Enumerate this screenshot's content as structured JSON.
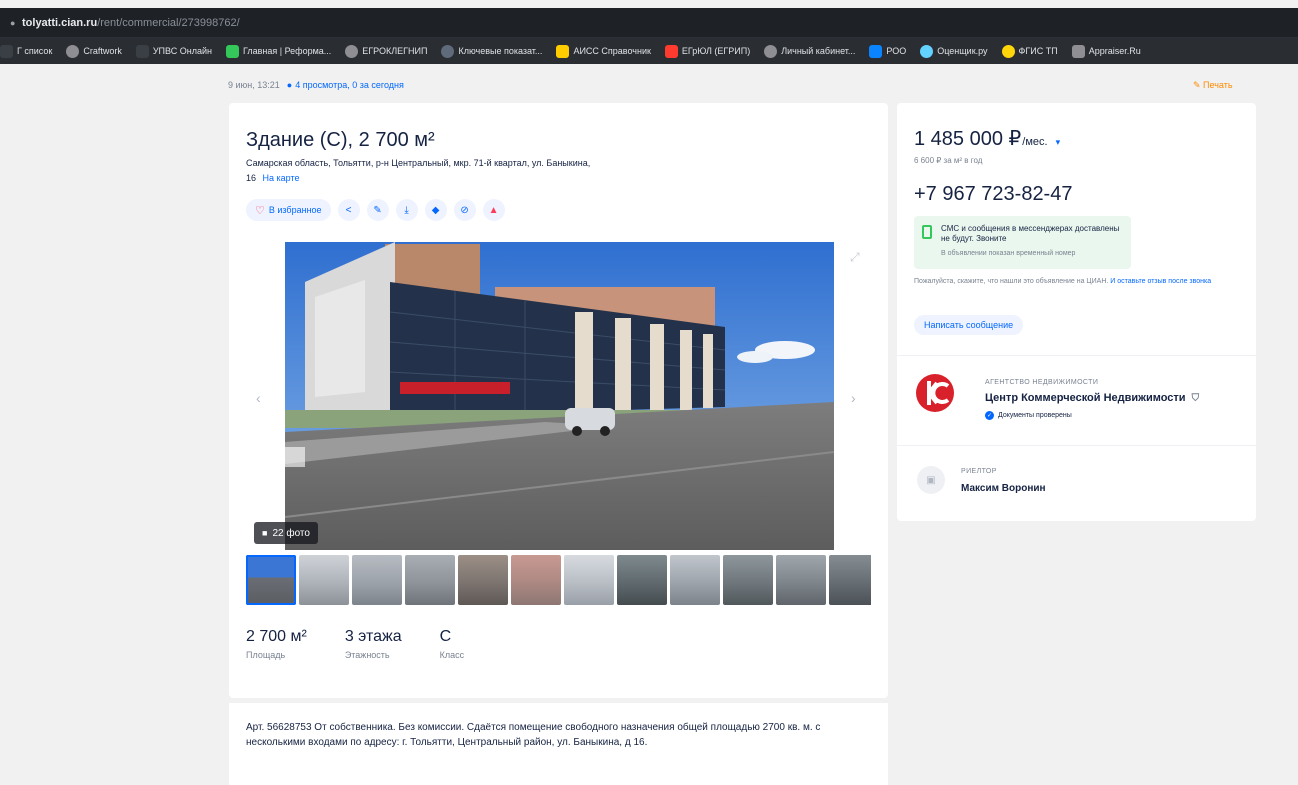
{
  "browser": {
    "url_host": "tolyatti.cian.ru",
    "url_path": "/rent/commercial/273998762/"
  },
  "bookmarks": [
    {
      "label": "Г список",
      "color": "#3a3f46"
    },
    {
      "label": "Craftwork",
      "color": "#8e8e93"
    },
    {
      "label": "УПВС Онлайн",
      "color": "#3a3f46"
    },
    {
      "label": "Главная | Реформа...",
      "color": "#34c759"
    },
    {
      "label": "ЕГРОКЛЕГНИП",
      "color": "#8e8e93"
    },
    {
      "label": "Ключевые показат...",
      "color": "#5f6b7a"
    },
    {
      "label": "АИСС Справочник",
      "color": "#ffcc00"
    },
    {
      "label": "ЕГрЮЛ (ЕГРИП)",
      "color": "#ff3b30"
    },
    {
      "label": "Личный кабинет...",
      "color": "#8e8e93"
    },
    {
      "label": "РОО",
      "color": "#0a84ff"
    },
    {
      "label": "Оценщик.ру",
      "color": "#64d2ff"
    },
    {
      "label": "ФГИС ТП",
      "color": "#ffd60a"
    },
    {
      "label": "Appraiser.Ru",
      "color": "#8e8e93"
    }
  ],
  "meta": {
    "date": "9 июн, 13:21",
    "views": "4 просмотра, 0 за сегодня",
    "print_label": "Печать"
  },
  "listing": {
    "title": "Здание (С), 2 700 м²",
    "address": "Самарская область, Тольятти, р-н Центральный, мкр. 71-й квартал, ул. Баныкина,",
    "address_house": "16",
    "map_link": "На карте",
    "favorite_label": "В избранное",
    "photo_count": "22 фото",
    "facts": [
      {
        "value": "2 700 м²",
        "label": "Площадь"
      },
      {
        "value": "3 этажа",
        "label": "Этажность"
      },
      {
        "value": "С",
        "label": "Класс"
      }
    ],
    "description": "Арт. 56628753 От собственника. Без комиссии. Сдаётся помещение свободного назначения общей площадью 2700 кв. м. с несколькими входами по адресу: г. Тольятти, Центральный район, ул. Баныкина, д 16."
  },
  "side": {
    "price": "1 485 000 ₽",
    "price_unit": "/мес.",
    "price_per_m2": "6 600 ₽ за м² в год",
    "phone": "+7 967 723-82-47",
    "sms_notice": "СМС и сообщения в мессенджерах доставлены не будут. Звоните",
    "sms_sub": "В объявлении показан временный номер",
    "note": "Пожалуйста, скажите, что нашли это объявление на ЦИАН.",
    "note_link": "И оставьте отзыв после звонка",
    "write_button": "Написать сообщение",
    "agency_kind": "АГЕНТСТВО НЕДВИЖИМОСТИ",
    "agency_name": "Центр Коммерческой Недвижимости",
    "agency_verified": "Документы проверены",
    "realtor_kind": "РИЕЛТОР",
    "realtor_name": "Максим Воронин"
  },
  "colors": {
    "accent": "#0468ff",
    "price_orange": "#ff8a00",
    "heart": "#ff3b5c",
    "agency_logo": "#d8212a"
  },
  "icons": {
    "actions": [
      "share-icon",
      "edit-icon",
      "download-icon",
      "pin-icon",
      "hide-icon",
      "report-icon"
    ]
  }
}
